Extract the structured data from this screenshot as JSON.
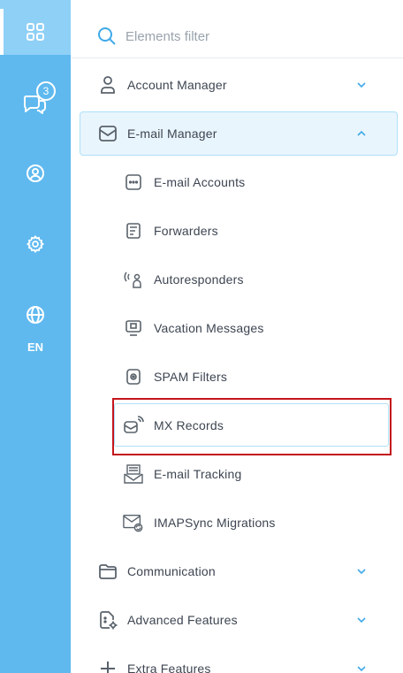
{
  "rail": {
    "chat_badge": "3",
    "language": "EN"
  },
  "search": {
    "placeholder": "Elements filter"
  },
  "menu": {
    "account_manager": "Account Manager",
    "email_manager": "E-mail Manager",
    "email_accounts": "E-mail Accounts",
    "forwarders": "Forwarders",
    "autoresponders": "Autoresponders",
    "vacation_messages": "Vacation Messages",
    "spam_filters": "SPAM Filters",
    "mx_records": "MX Records",
    "email_tracking": "E-mail Tracking",
    "imapsync_migrations": "IMAPSync Migrations",
    "communication": "Communication",
    "advanced_features": "Advanced Features",
    "extra_features": "Extra Features"
  },
  "colors": {
    "rail": "#5fb9ef",
    "rail_active": "#8fd0f6",
    "accent": "#3fa9e8",
    "highlight_box": "#c4161c",
    "expanded_bg": "#e9f5fd"
  }
}
